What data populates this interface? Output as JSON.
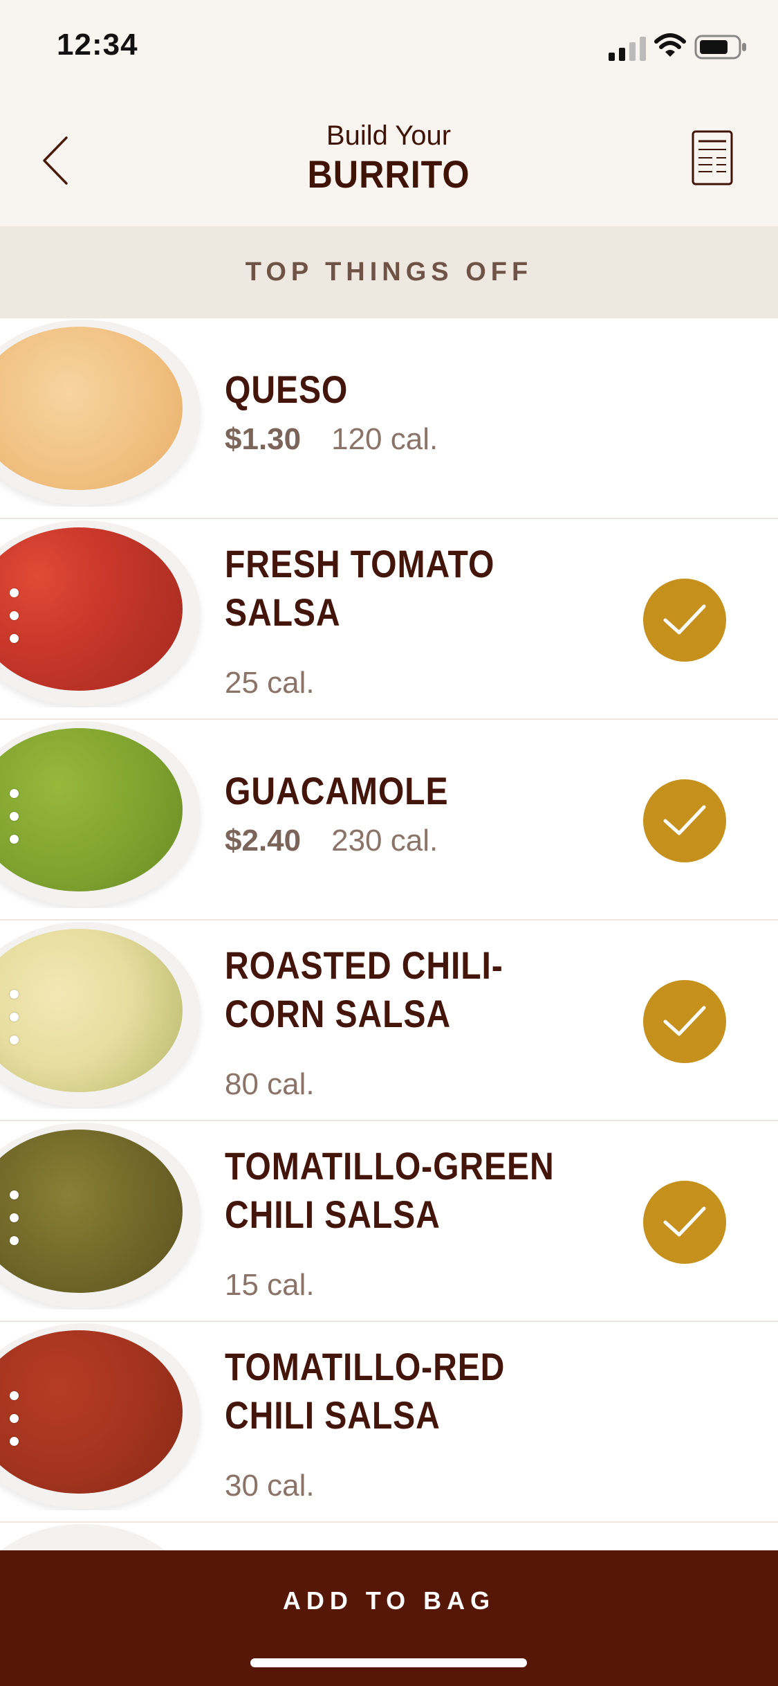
{
  "status_bar": {
    "time": "12:34"
  },
  "header": {
    "title_small": "Build Your",
    "title_big": "BURRITO"
  },
  "section": {
    "title": "TOP THINGS OFF"
  },
  "items": [
    {
      "name": "QUESO",
      "price": "$1.30",
      "calories": "120 cal.",
      "selected": false,
      "food_color": "#f2c58a"
    },
    {
      "name": "FRESH TOMATO SALSA",
      "price": "",
      "calories": "25 cal.",
      "selected": true,
      "food_color": "#c8372a"
    },
    {
      "name": "GUACAMOLE",
      "price": "$2.40",
      "calories": "230 cal.",
      "selected": true,
      "food_color": "#7fa22f"
    },
    {
      "name": "ROASTED CHILI-CORN SALSA",
      "price": "",
      "calories": "80 cal.",
      "selected": true,
      "food_color": "#e7dd9f"
    },
    {
      "name": "TOMATILLO-GREEN CHILI SALSA",
      "price": "",
      "calories": "15 cal.",
      "selected": true,
      "food_color": "#6f6628"
    },
    {
      "name": "TOMATILLO-RED CHILI SALSA",
      "price": "",
      "calories": "30 cal.",
      "selected": false,
      "food_color": "#a2331e"
    }
  ],
  "bottom": {
    "button_label": "ADD TO BAG"
  },
  "colors": {
    "accent_check": "#c6901d",
    "brand_dark": "#561707",
    "header_bg": "#f8f5f1",
    "section_bg": "#efe8e1"
  },
  "icons": {
    "back": "chevron-left-icon",
    "nutrition": "receipt-icon",
    "check": "checkmark-icon"
  }
}
